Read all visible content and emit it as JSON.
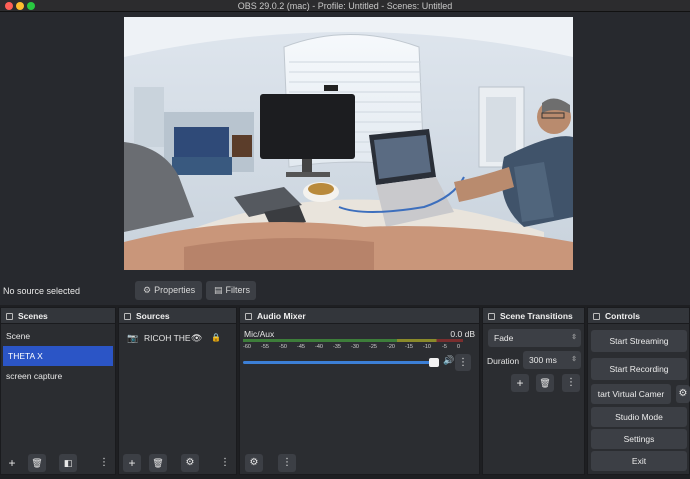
{
  "window": {
    "title": "OBS 29.0.2 (mac) - Profile: Untitled - Scenes: Untitled"
  },
  "source_bar": {
    "status": "No source selected",
    "properties_label": "Properties",
    "filters_label": "Filters"
  },
  "scenes": {
    "title": "Scenes",
    "items": [
      "Scene",
      "THETA X",
      "screen capture"
    ],
    "selected_index": 1
  },
  "sources": {
    "title": "Sources",
    "items": [
      {
        "name": "RICOH THE",
        "visible": true,
        "locked": true
      }
    ]
  },
  "audio_mixer": {
    "title": "Audio Mixer",
    "channel": "Mic/Aux",
    "level": "0.0 dB",
    "ticks": [
      "-60",
      "-55",
      "-50",
      "-45",
      "-40",
      "-35",
      "-30",
      "-25",
      "-20",
      "-15",
      "-10",
      "-5",
      "0"
    ],
    "volume_fraction": 0.97
  },
  "scene_transitions": {
    "title": "Scene Transitions",
    "transition": "Fade",
    "duration_label": "Duration",
    "duration_value": "300 ms"
  },
  "controls": {
    "title": "Controls",
    "start_streaming": "Start Streaming",
    "start_recording": "Start Recording",
    "start_virtual_camera": "tart Virtual Camer",
    "studio_mode": "Studio Mode",
    "settings": "Settings",
    "exit": "Exit"
  },
  "colors": {
    "selected": "#2b55c6",
    "panel": "#2b2d31",
    "header": "#33363b",
    "slider": "#3c7fd6"
  },
  "icons": {
    "scenes": "scenes-icon",
    "sources": "sources-icon",
    "audio": "audio-mixer-icon",
    "transitions": "transitions-icon",
    "controls": "controls-icon"
  }
}
